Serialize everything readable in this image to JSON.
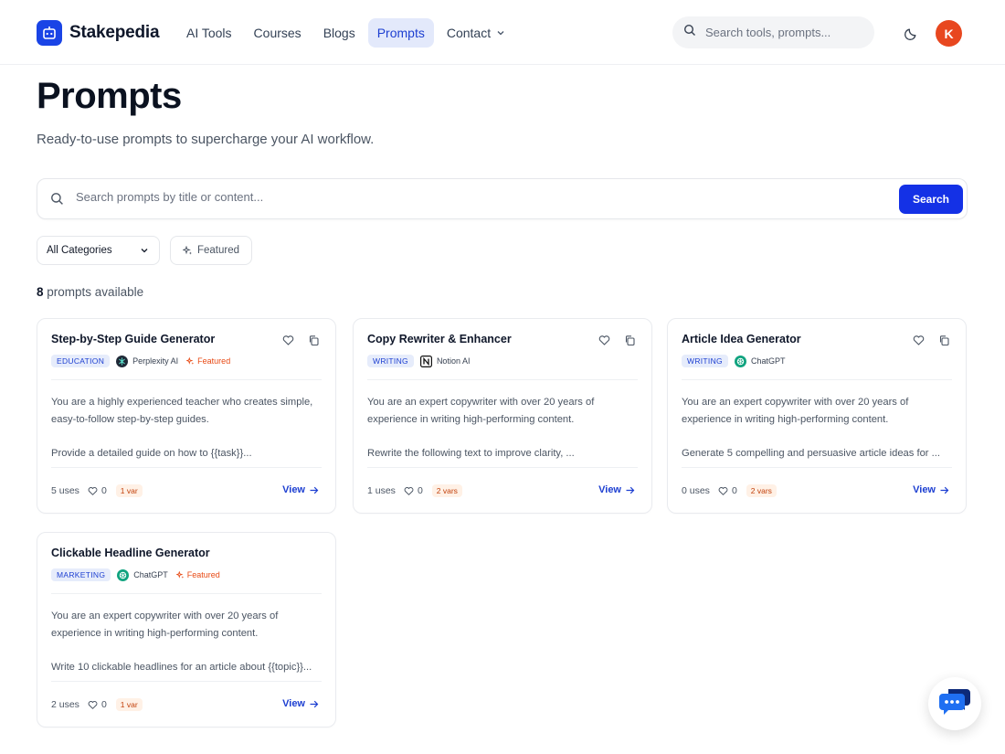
{
  "app": {
    "name": "Stakepedia"
  },
  "nav": {
    "items": [
      {
        "label": "AI Tools",
        "active": false
      },
      {
        "label": "Courses",
        "active": false
      },
      {
        "label": "Blogs",
        "active": false
      },
      {
        "label": "Prompts",
        "active": true
      },
      {
        "label": "Contact",
        "active": false,
        "has_dropdown": true
      }
    ],
    "search_placeholder": "Search tools, prompts...",
    "theme_icon": "moon-icon",
    "avatar_initial": "K",
    "avatar_color": "#e8471f"
  },
  "page": {
    "title": "Prompts",
    "subtitle": "Ready-to-use prompts to supercharge your AI workflow."
  },
  "search": {
    "placeholder": "Search prompts by title or content...",
    "button_label": "Search"
  },
  "filters": {
    "category_selected": "All Categories",
    "featured_label": "Featured"
  },
  "results": {
    "count": "8",
    "count_suffix": "prompts available"
  },
  "cards": [
    {
      "title": "Step-by-Step Guide Generator",
      "category": "EDUCATION",
      "model": "Perplexity AI",
      "model_icon": "perplexity-icon",
      "featured": "Featured",
      "body_line1": "You are a highly experienced teacher who creates simple,",
      "body_line2": "easy-to-follow step-by-step guides.",
      "body_line3": "Provide a detailed guide on how to {{task}}...",
      "uses": "5 uses",
      "likes": "0",
      "vars": "1 var",
      "view_label": "View"
    },
    {
      "title": "Copy Rewriter & Enhancer",
      "category": "WRITING",
      "model": "Notion AI",
      "model_icon": "notion-icon",
      "featured": "",
      "body_line1": "You are an expert copywriter with over 20 years of",
      "body_line2": "experience in writing high-performing content.",
      "body_line3": "Rewrite the following text to improve clarity, ...",
      "uses": "1 uses",
      "likes": "0",
      "vars": "2 vars",
      "view_label": "View"
    },
    {
      "title": "Article Idea Generator",
      "category": "WRITING",
      "model": "ChatGPT",
      "model_icon": "chatgpt-icon",
      "featured": "",
      "body_line1": "You are an expert copywriter with over 20 years of",
      "body_line2": "experience in writing high-performing content.",
      "body_line3": "Generate 5 compelling and persuasive article ideas for ...",
      "uses": "0 uses",
      "likes": "0",
      "vars": "2 vars",
      "view_label": "View"
    },
    {
      "title": "Clickable Headline Generator",
      "category": "MARKETING",
      "model": "ChatGPT",
      "model_icon": "chatgpt-icon",
      "featured": "Featured",
      "body_line1": "You are an expert copywriter with over 20 years of",
      "body_line2": "experience in writing high-performing content.",
      "body_line3": "Write 10 clickable headlines for an article about {{topic}}...",
      "uses": "2 uses",
      "likes": "0",
      "vars": "1 var",
      "view_label": "View"
    }
  ],
  "chat_widget": {
    "icon": "chat-bubbles-icon"
  },
  "colors": {
    "accent": "#1431e6",
    "featured": "#e84a15",
    "tag_bg": "#e6ecfb"
  }
}
